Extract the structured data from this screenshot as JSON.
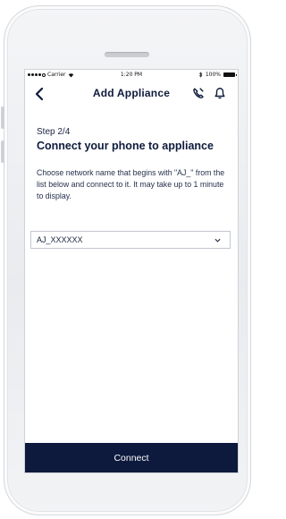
{
  "status_bar": {
    "carrier": "Carrier",
    "time": "1:20 PM",
    "battery": "100%"
  },
  "nav": {
    "title": "Add Appliance",
    "back_icon": "chevron-left-icon",
    "phone_icon": "phone-icon",
    "bell_icon": "bell-icon"
  },
  "main": {
    "step": "Step 2/4",
    "heading": "Connect your phone to appliance",
    "description": "Choose network name that begins with \"AJ_\" from the list below and connect to it. It may take up to 1 minute to display."
  },
  "network_select": {
    "selected": "AJ_XXXXXX"
  },
  "footer": {
    "connect_label": "Connect"
  },
  "colors": {
    "primary": "#0d1a3d",
    "text": "#1b2440"
  }
}
